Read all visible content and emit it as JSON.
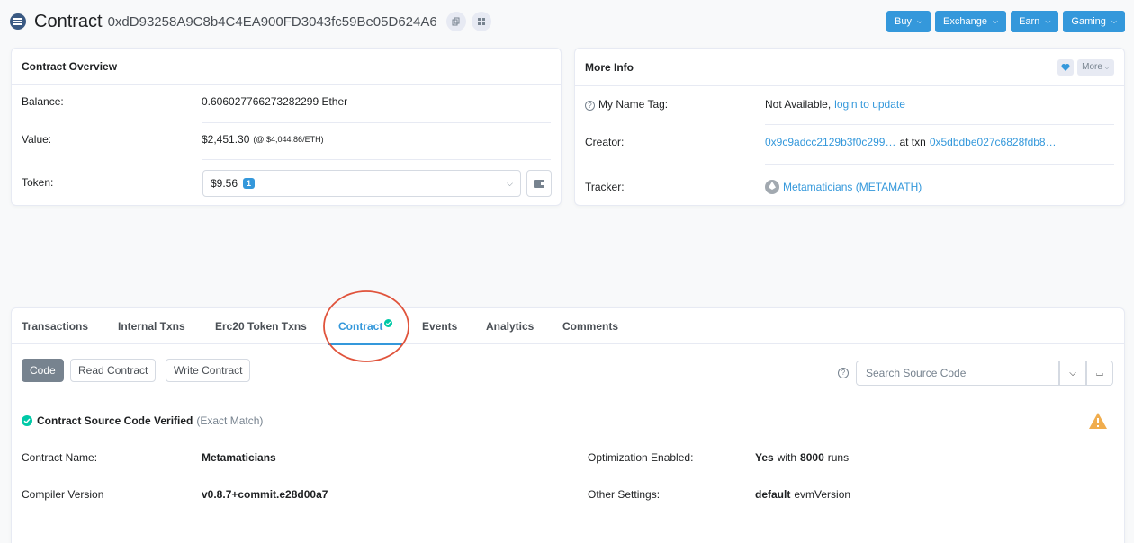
{
  "header": {
    "title": "Contract",
    "address": "0xdD93258A9C8b4C4EA900FD3043fc59Be05D624A6",
    "nav": [
      {
        "label": "Buy"
      },
      {
        "label": "Exchange"
      },
      {
        "label": "Earn"
      },
      {
        "label": "Gaming"
      }
    ]
  },
  "overview": {
    "title": "Contract Overview",
    "balance_label": "Balance:",
    "balance_value": "0.606027766273282299 Ether",
    "value_label": "Value:",
    "value_value": "$2,451.30",
    "value_note": "(@ $4,044.86/ETH)",
    "token_label": "Token:",
    "token_value": "$9.56",
    "token_count": "1"
  },
  "more_info": {
    "title": "More Info",
    "more_label": "More",
    "name_tag_label": "My Name Tag:",
    "name_tag_value": "Not Available,",
    "name_tag_link": "login to update",
    "creator_label": "Creator:",
    "creator_address": "0x9c9adcc2129b3f0c299…",
    "creator_at": "at txn",
    "creator_txn": "0x5dbdbe027c6828fdb8…",
    "tracker_label": "Tracker:",
    "tracker_value": "Metamaticians (METAMATH)"
  },
  "tabs": [
    {
      "label": "Transactions"
    },
    {
      "label": "Internal Txns"
    },
    {
      "label": "Erc20 Token Txns"
    },
    {
      "label": "Contract"
    },
    {
      "label": "Events"
    },
    {
      "label": "Analytics"
    },
    {
      "label": "Comments"
    }
  ],
  "contract_tab": {
    "buttons": [
      {
        "label": "Code"
      },
      {
        "label": "Read Contract"
      },
      {
        "label": "Write Contract"
      }
    ],
    "search_placeholder": "Search Source Code",
    "verified_label": "Contract Source Code Verified",
    "verified_note": "(Exact Match)",
    "name_label": "Contract Name:",
    "name_value": "Metamaticians",
    "compiler_label": "Compiler Version",
    "compiler_value": "v0.8.7+commit.e28d00a7",
    "opt_label": "Optimization Enabled:",
    "opt_yes": "Yes",
    "opt_with": "with",
    "opt_runs_num": "8000",
    "opt_runs": "runs",
    "other_label": "Other Settings:",
    "other_value": "default",
    "other_suffix": "evmVersion"
  },
  "colors": {
    "accent": "#3498db",
    "verified": "#00c9a7",
    "warning": "#f0ad4e",
    "annotation_circle": "#e0533b"
  }
}
